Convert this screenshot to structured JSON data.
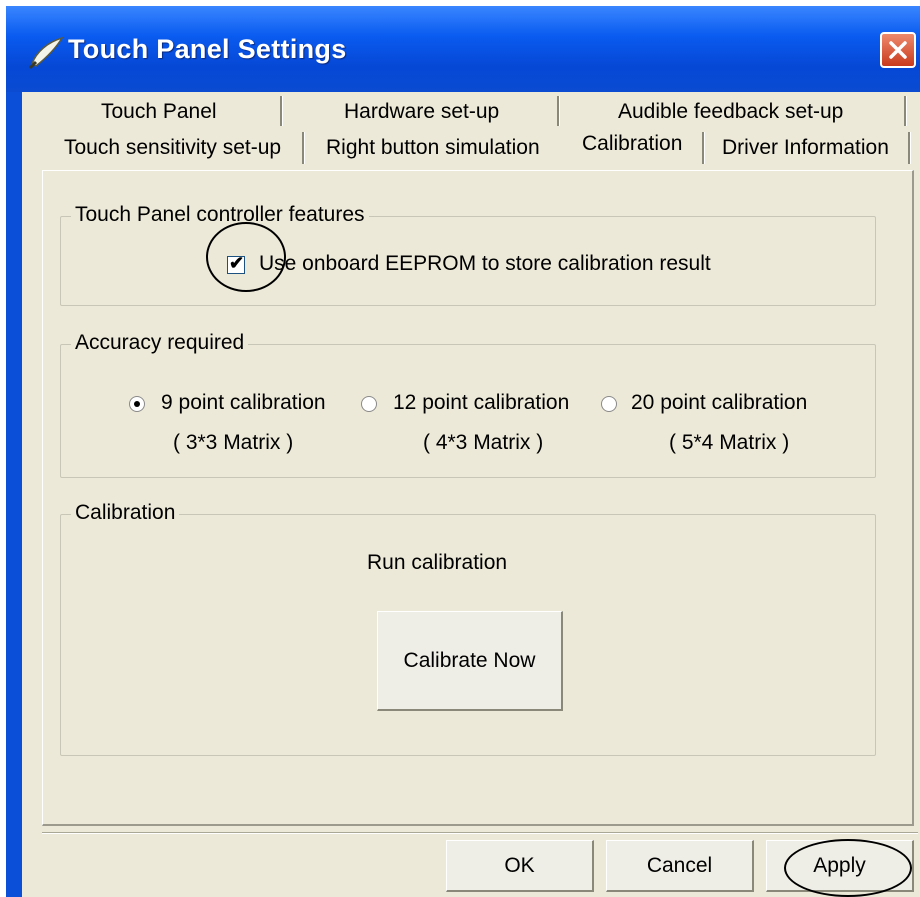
{
  "window": {
    "title": "Touch Panel Settings",
    "close_icon": "close-icon"
  },
  "tabs": {
    "row1": [
      "Touch Panel",
      "Hardware set-up",
      "Audible feedback set-up"
    ],
    "row2": [
      "Touch sensitivity set-up",
      "Right button simulation",
      "Calibration",
      "Driver Information"
    ],
    "selected": "Calibration"
  },
  "controller_features": {
    "legend": "Touch Panel controller features",
    "eeprom_checkbox": {
      "label": "Use onboard EEPROM to store calibration result",
      "checked": true
    }
  },
  "accuracy": {
    "legend": "Accuracy required",
    "options": [
      {
        "label": "9 point calibration",
        "matrix": "( 3*3 Matrix )",
        "selected": true
      },
      {
        "label": "12 point calibration",
        "matrix": "( 4*3 Matrix )",
        "selected": false
      },
      {
        "label": "20 point calibration",
        "matrix": "( 5*4 Matrix )",
        "selected": false
      }
    ]
  },
  "calibration": {
    "legend": "Calibration",
    "run_label": "Run calibration",
    "button_label": "Calibrate Now"
  },
  "footer": {
    "ok_label": "OK",
    "cancel_label": "Cancel",
    "apply_label": "Apply"
  },
  "colors": {
    "titlebar": "#0a5bf0",
    "client_bg": "#ece9d8",
    "close_button": "#d9542f"
  }
}
